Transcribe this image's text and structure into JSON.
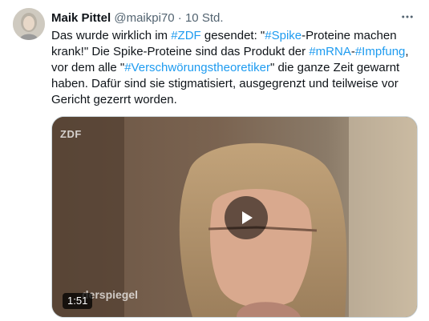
{
  "tweet": {
    "name": "Maik Pittel",
    "handle": "@maikpi70",
    "separator": "·",
    "time": "10 Std.",
    "text_parts": [
      {
        "t": "Das wurde wirklich im ",
        "tag": false
      },
      {
        "t": "#ZDF",
        "tag": true
      },
      {
        "t": " gesendet: \"",
        "tag": false
      },
      {
        "t": "#Spike",
        "tag": true
      },
      {
        "t": "-Proteine machen krank!\" Die Spike-Proteine sind das Produkt der ",
        "tag": false
      },
      {
        "t": "#mRNA",
        "tag": true
      },
      {
        "t": "-",
        "tag": false
      },
      {
        "t": "#Impfung",
        "tag": true
      },
      {
        "t": ", vor dem alle \"",
        "tag": false
      },
      {
        "t": "#Verschwörungstheoretiker",
        "tag": true
      },
      {
        "t": "\" die ganze Zeit gewarnt haben. Dafür sind sie stigmatisiert, ausgegrenzt und teilweise vor Gericht gezerrt worden.",
        "tag": false
      }
    ]
  },
  "media": {
    "duration": "1:51",
    "channel_logo": "ZDF",
    "watermark": "derspiegel"
  },
  "icons": {
    "more": "more-horizontal-icon",
    "play": "play-icon"
  },
  "colors": {
    "link": "#1d9bf0",
    "text": "#0f1419",
    "secondary": "#536471"
  }
}
